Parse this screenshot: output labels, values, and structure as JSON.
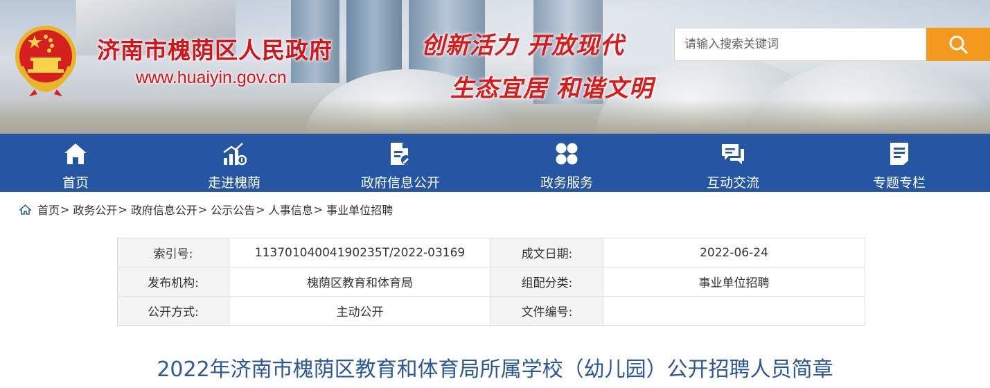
{
  "header": {
    "site_title": "济南市槐荫区人民政府",
    "site_url": "www.huaiyin.gov.cn",
    "slogan_line1": "创新活力  开放现代",
    "slogan_line2": "生态宜居  和谐文明",
    "search_placeholder": "请输入搜索关键词",
    "search_button_color": "#f39a1e",
    "title_color": "#d2141b"
  },
  "nav": {
    "background": "#2655a3",
    "items": [
      {
        "label": "首页",
        "icon": "home-icon"
      },
      {
        "label": "走进槐荫",
        "icon": "bar-chart-icon"
      },
      {
        "label": "政府信息公开",
        "icon": "document-edit-icon"
      },
      {
        "label": "政务服务",
        "icon": "grid-icon"
      },
      {
        "label": "互动交流",
        "icon": "chat-icon"
      },
      {
        "label": "专题专栏",
        "icon": "list-document-icon"
      }
    ]
  },
  "breadcrumb": {
    "items": [
      "首页",
      "政务公开",
      "政府信息公开",
      "公示公告",
      "人事信息",
      "事业单位招聘"
    ],
    "separator": ">"
  },
  "meta": {
    "rows": [
      {
        "k1": "索引号:",
        "v1": "11370104004190235T/2022-03169",
        "k2": "成文日期:",
        "v2": "2022-06-24"
      },
      {
        "k1": "发布机构:",
        "v1": "槐荫区教育和体育局",
        "k2": "组配分类:",
        "v2": "事业单位招聘"
      },
      {
        "k1": "公开方式:",
        "v1": "主动公开",
        "k2": "文件编号:",
        "v2": ""
      }
    ]
  },
  "article": {
    "title": "2022年济南市槐荫区教育和体育局所属学校（幼儿园）公开招聘人员简章"
  }
}
